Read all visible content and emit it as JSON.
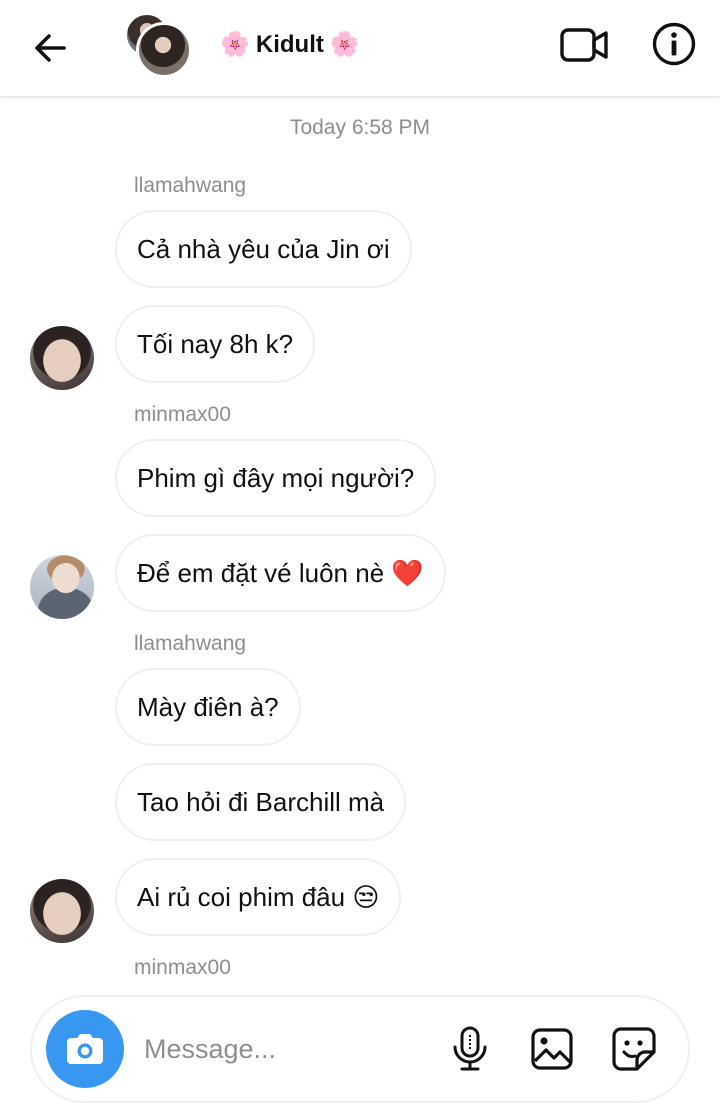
{
  "header": {
    "title": "Kidult",
    "title_emoji_left": "🌸",
    "title_emoji_right": "🌸",
    "icons": {
      "back": "arrow-left-icon",
      "video": "video-camera-icon",
      "info": "info-circle-icon"
    }
  },
  "thread": {
    "timestamp": "Today 6:58 PM",
    "messages": [
      {
        "sender": "llamahwang",
        "text": "Cả nhà yêu của Jin ơi"
      },
      {
        "text": "Tối nay 8h k?"
      },
      {
        "sender": "minmax00",
        "text": "Phim gì đây mọi người?"
      },
      {
        "text": "Để em đặt vé luôn nè ❤️"
      },
      {
        "sender": "llamahwang",
        "text": "Mày điên à?"
      },
      {
        "text": "Tao hỏi đi Barchill mà"
      },
      {
        "text": "Ai rủ coi phim đâu 😒"
      }
    ],
    "trailing_sender": "minmax00"
  },
  "composer": {
    "placeholder": "Message...",
    "value": "",
    "icons": {
      "camera": "camera-icon",
      "mic": "microphone-icon",
      "gallery": "image-gallery-icon",
      "sticker": "sticker-icon"
    }
  },
  "colors": {
    "accent": "#3897f0",
    "meta_text": "#8e8e8e",
    "bubble_border": "#efefef"
  }
}
